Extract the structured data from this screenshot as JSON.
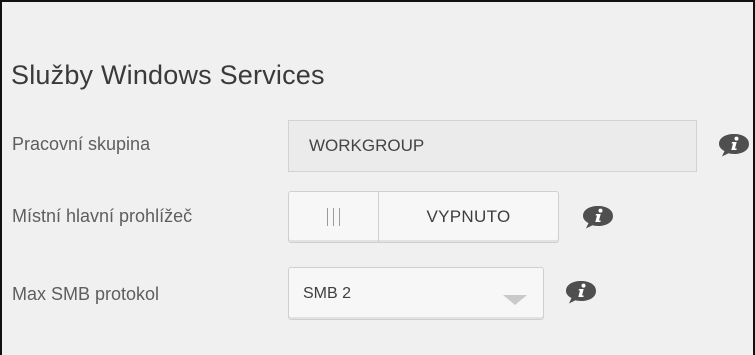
{
  "section": {
    "title": "Služby Windows Services"
  },
  "workgroup": {
    "label": "Pracovní skupina",
    "value": "WORKGROUP"
  },
  "local_master_browser": {
    "label": "Místní hlavní prohlížeč",
    "state": "VYPNUTO"
  },
  "max_smb": {
    "label": "Max SMB protokol",
    "selected": "SMB 2"
  },
  "icons": {
    "info": "info-icon"
  },
  "colors": {
    "info_icon": "#4f4f4f",
    "panel_bg": "#f0f0f0",
    "input_bg": "#ebebeb"
  }
}
